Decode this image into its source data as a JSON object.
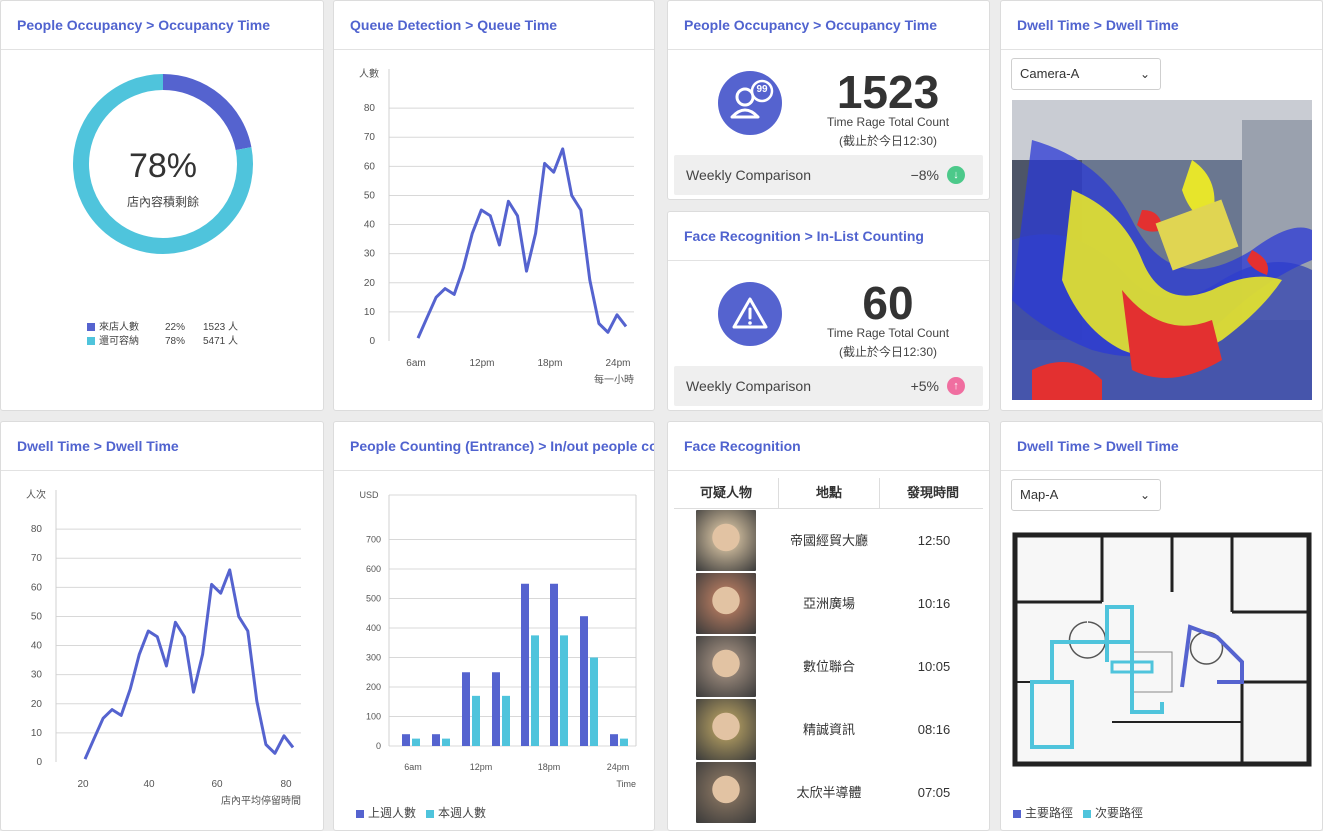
{
  "cards": {
    "occupancy_donut": {
      "title": "People Occupancy > Occupancy Time",
      "percent_text": "78%",
      "center_label": "店內容積剩餘",
      "legend": [
        {
          "name": "來店人數",
          "pct": "22%",
          "count": "1523 人",
          "color": "#5563cf"
        },
        {
          "name": "還可容納",
          "pct": "78%",
          "count": "5471 人",
          "color": "#4fc4dc"
        }
      ]
    },
    "queue_time": {
      "title": "Queue Detection > Queue Time",
      "y_unit": "人數",
      "x_unit": "每一小時"
    },
    "occupancy_count": {
      "title": "People Occupancy > Occupancy Time",
      "icon_badge": "99",
      "value": "1523",
      "label": "Time Rage Total Count",
      "note": "(截止於今日12:30)",
      "weekly_label": "Weekly Comparison",
      "weekly_value": "−8%",
      "weekly_icon": "arrow-down-icon",
      "weekly_color": "#4cc98a"
    },
    "face_inlist": {
      "title": "Face Recognition > In-List Counting",
      "value": "60",
      "label": "Time Rage Total Count",
      "note": "(截止於今日12:30)",
      "weekly_label": "Weekly Comparison",
      "weekly_value": "+5%",
      "weekly_icon": "arrow-up-icon",
      "weekly_color": "#f06ea0"
    },
    "dwell_heatmap": {
      "title": "Dwell Time > Dwell Time",
      "camera_select": "Camera-A"
    },
    "dwell_time_chart": {
      "title": "Dwell Time > Dwell Time",
      "y_unit": "人次",
      "x_unit": "店內平均停留時間"
    },
    "people_counting": {
      "title": "People Counting (Entrance) >  In/out people cour",
      "y_unit": "USD",
      "x_unit": "Time",
      "legend": [
        {
          "name": "上週人數",
          "color": "#5563cf"
        },
        {
          "name": "本週人數",
          "color": "#4fc4dc"
        }
      ]
    },
    "face_recognition": {
      "title": "Face Recognition",
      "columns": [
        "可疑人物",
        "地點",
        "發現時間"
      ],
      "rows": [
        {
          "place": "帝國經貿大廳",
          "time": "12:50"
        },
        {
          "place": "亞洲廣場",
          "time": "10:16"
        },
        {
          "place": "數位聯合",
          "time": "10:05"
        },
        {
          "place": "精誠資訊",
          "time": "08:16"
        },
        {
          "place": "太欣半導體",
          "time": "07:05"
        }
      ]
    },
    "dwell_map": {
      "title": "Dwell Time > Dwell Time",
      "map_select": "Map-A",
      "legend": [
        {
          "name": "主要路徑",
          "color": "#5563cf"
        },
        {
          "name": "次要路徑",
          "color": "#4fc4dc"
        }
      ]
    }
  },
  "chart_data": [
    {
      "type": "pie",
      "categories": [
        "來店人數",
        "還可容納"
      ],
      "values": [
        22,
        78
      ]
    },
    {
      "type": "line",
      "ylabel": "人數",
      "xlabel": "每一小時",
      "x_ticks": [
        "6am",
        "12pm",
        "18pm",
        "24pm"
      ],
      "y_ticks": [
        0,
        10,
        20,
        30,
        40,
        50,
        60,
        70,
        80
      ],
      "ylim": [
        0,
        90
      ],
      "x": [
        0,
        1,
        2,
        3,
        4,
        5,
        6,
        7,
        8,
        9,
        10,
        11,
        12,
        13,
        14,
        15,
        16,
        17,
        18,
        19,
        20,
        21,
        22
      ],
      "values": [
        1,
        8,
        15,
        18,
        16,
        25,
        37,
        45,
        43,
        33,
        48,
        43,
        24,
        37,
        61,
        58,
        66,
        50,
        45,
        21,
        6,
        3,
        9,
        5
      ],
      "grid": true
    },
    {
      "type": "line",
      "ylabel": "人次",
      "xlabel": "店內平均停留時間",
      "x_ticks": [
        "20",
        "40",
        "60",
        "80"
      ],
      "y_ticks": [
        0,
        10,
        20,
        30,
        40,
        50,
        60,
        70,
        80
      ],
      "ylim": [
        0,
        90
      ],
      "values": [
        1,
        8,
        15,
        18,
        16,
        25,
        37,
        45,
        43,
        33,
        48,
        43,
        24,
        37,
        61,
        58,
        66,
        50,
        45,
        21,
        6,
        3,
        9,
        5
      ],
      "grid": true
    },
    {
      "type": "bar",
      "ylabel": "USD",
      "xlabel": "Time",
      "x_ticks": [
        "6am",
        "12pm",
        "18pm",
        "24pm"
      ],
      "y_ticks": [
        0,
        100,
        200,
        300,
        400,
        500,
        600,
        700
      ],
      "ylim": [
        0,
        800
      ],
      "series": [
        {
          "name": "上週人數",
          "values": [
            40,
            40,
            250,
            250,
            550,
            550,
            440,
            40
          ]
        },
        {
          "name": "本週人數",
          "values": [
            25,
            25,
            170,
            170,
            375,
            375,
            300,
            25
          ]
        }
      ],
      "grid": true
    }
  ]
}
